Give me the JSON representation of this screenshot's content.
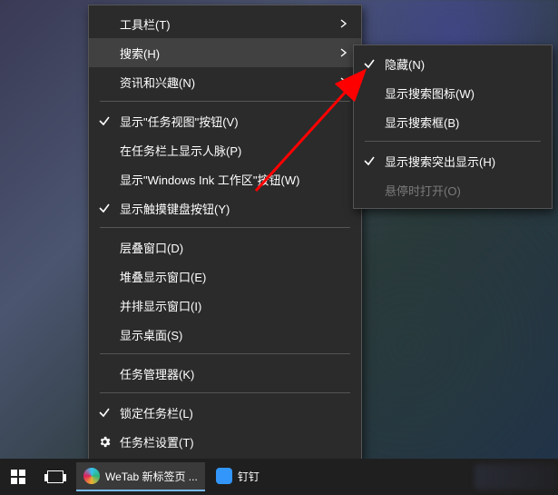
{
  "menu_main": {
    "toolbars": {
      "label": "工具栏(T)"
    },
    "search": {
      "label": "搜索(H)"
    },
    "news": {
      "label": "资讯和兴趣(N)"
    },
    "taskview_btn": {
      "label": "显示\"任务视图\"按钮(V)"
    },
    "people": {
      "label": "在任务栏上显示人脉(P)"
    },
    "ink": {
      "label": "显示\"Windows Ink 工作区\"按钮(W)"
    },
    "touchkb": {
      "label": "显示触摸键盘按钮(Y)"
    },
    "cascade": {
      "label": "层叠窗口(D)"
    },
    "stacked": {
      "label": "堆叠显示窗口(E)"
    },
    "sidebyside": {
      "label": "并排显示窗口(I)"
    },
    "showdesktop": {
      "label": "显示桌面(S)"
    },
    "taskmgr": {
      "label": "任务管理器(K)"
    },
    "lock": {
      "label": "锁定任务栏(L)"
    },
    "settings": {
      "label": "任务栏设置(T)"
    }
  },
  "menu_sub": {
    "hidden": {
      "label": "隐藏(N)"
    },
    "showicon": {
      "label": "显示搜索图标(W)"
    },
    "showbox": {
      "label": "显示搜索框(B)"
    },
    "highlights": {
      "label": "显示搜索突出显示(H)"
    },
    "open_hover": {
      "label": "悬停时打开(O)"
    }
  },
  "taskbar": {
    "wetab": {
      "label": "WeTab 新标签页 ..."
    },
    "dingtalk": {
      "label": "钉钉"
    }
  },
  "colors": {
    "arrow": "#ff0000"
  }
}
